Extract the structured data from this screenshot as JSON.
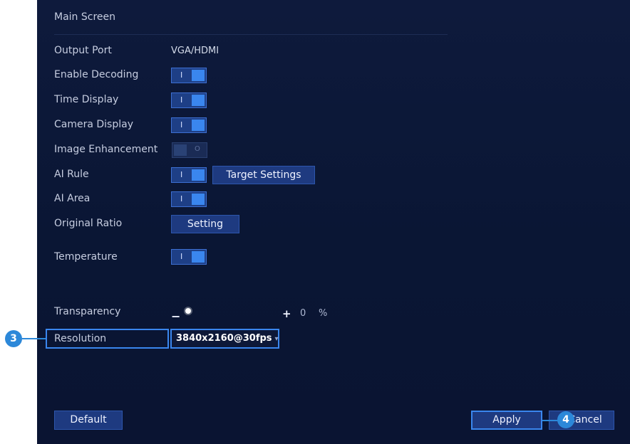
{
  "title": "Main Screen",
  "rows": {
    "output_port": {
      "label": "Output Port",
      "value": "VGA/HDMI"
    },
    "enable_decoding": {
      "label": "Enable Decoding",
      "on": true
    },
    "time_display": {
      "label": "Time Display",
      "on": true
    },
    "camera_display": {
      "label": "Camera Display",
      "on": true
    },
    "image_enhancement": {
      "label": "Image Enhancement",
      "on": false
    },
    "ai_rule": {
      "label": "AI Rule",
      "on": true,
      "button": "Target Settings"
    },
    "ai_area": {
      "label": "AI Area",
      "on": true
    },
    "original_ratio": {
      "label": "Original Ratio",
      "button": "Setting"
    },
    "temperature": {
      "label": "Temperature",
      "on": true
    },
    "transparency": {
      "label": "Transparency",
      "minus": "−",
      "plus": "+",
      "value": "0",
      "unit": "%"
    },
    "resolution": {
      "label": "Resolution",
      "value": "3840x2160@30fps"
    }
  },
  "toggle_on_mark": "I",
  "toggle_off_mark": "O",
  "buttons": {
    "default": "Default",
    "apply": "Apply",
    "cancel": "Cancel"
  },
  "callouts": {
    "resolution": "3",
    "apply": "4"
  },
  "colors": {
    "panel_bg": "#0a1634",
    "accent": "#3a86ee",
    "button_bg": "#1e3a80",
    "callout": "#2c88d9"
  }
}
